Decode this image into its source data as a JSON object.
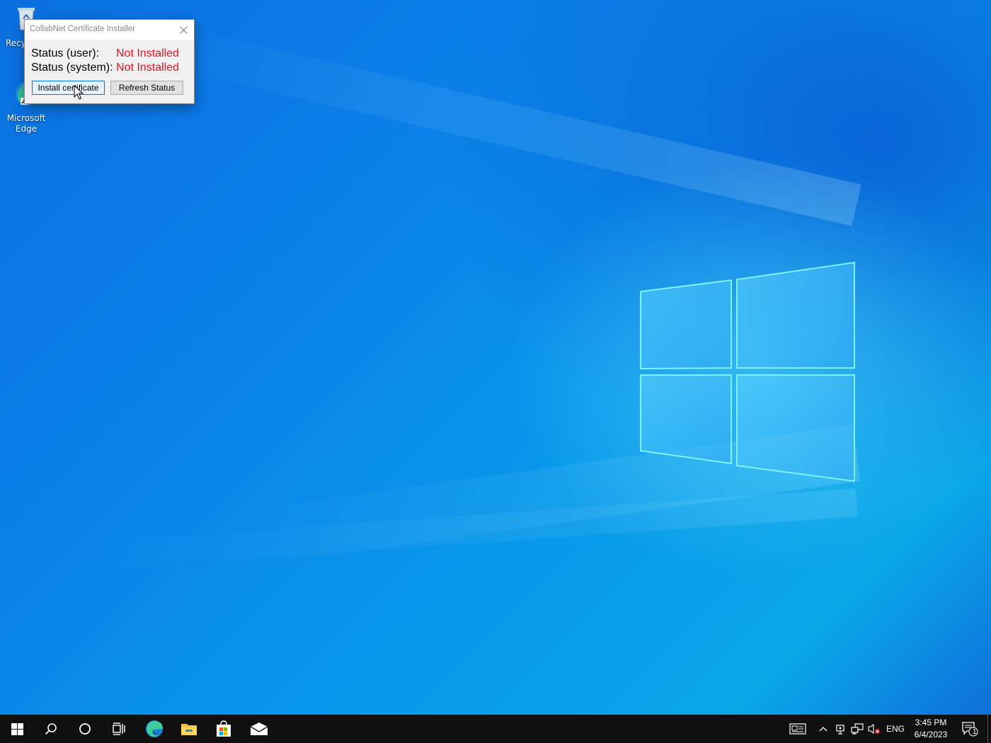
{
  "desktop": {
    "icons": [
      {
        "label": "Recycle Bin",
        "visible_label": "Recy",
        "icon": "recycle-bin-icon"
      },
      {
        "label_line1": "Microsoft",
        "label_line2": "Edge",
        "icon": "edge-icon"
      }
    ]
  },
  "dialog": {
    "title": "CollabNet Certificate Installer",
    "status_user_label": "Status (user):",
    "status_user_value": "Not Installed",
    "status_system_label": "Status (system):",
    "status_system_value": "Not Installed",
    "install_button": "Install certificate",
    "refresh_button": "Refresh Status",
    "status_color": "#e81123"
  },
  "taskbar": {
    "items": [
      "start-icon",
      "search-icon",
      "cortana-icon",
      "task-view-icon",
      "edge-icon",
      "file-explorer-icon",
      "store-icon",
      "mail-icon"
    ],
    "tray": {
      "language": "ENG",
      "time": "3:45 PM",
      "date": "6/4/2023",
      "notification_count": "1"
    }
  }
}
